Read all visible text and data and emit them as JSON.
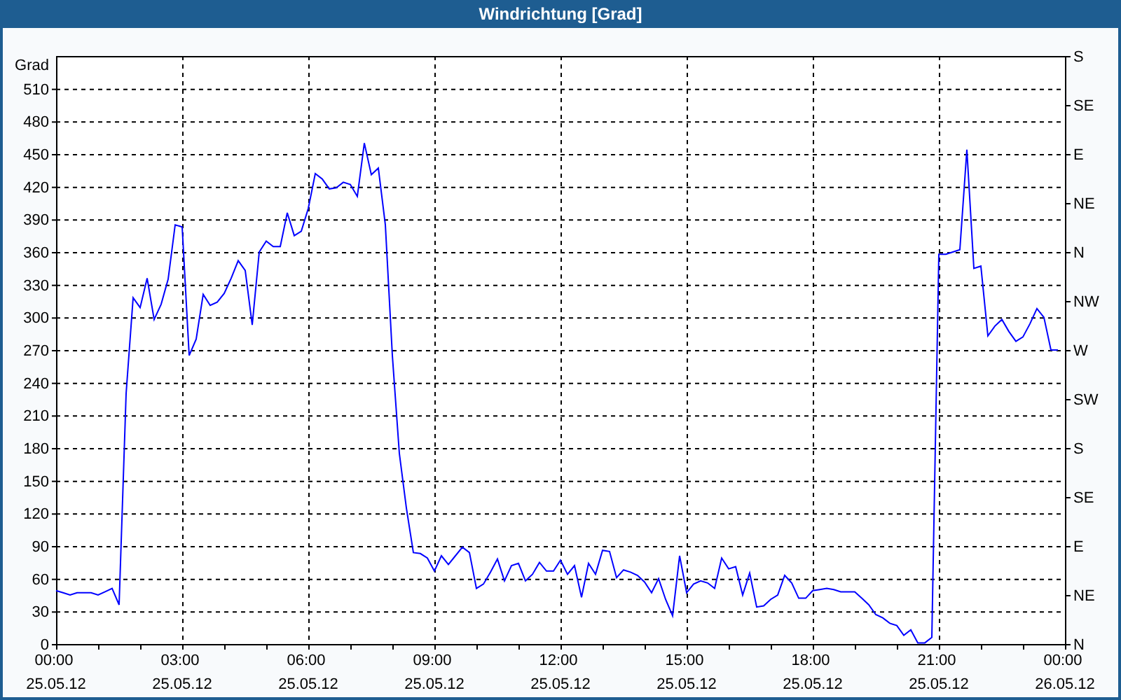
{
  "window": {
    "title": "Windrichtung [Grad]"
  },
  "chart": {
    "right_axis_labels": [
      "S",
      "SE",
      "E",
      "NE",
      "N",
      "NW",
      "W",
      "SW",
      "S",
      "SE",
      "E",
      "NE",
      "N"
    ],
    "chart_data": {
      "type": "line",
      "ylabel": "Grad",
      "ylim": [
        0,
        540
      ],
      "categories": [
        "00:00 25.05.12",
        null,
        null,
        null,
        null,
        null,
        null,
        null,
        null,
        null,
        null,
        null,
        null,
        null,
        null,
        null,
        null,
        null,
        "03:00 25.05.12",
        null,
        null,
        null,
        null,
        null,
        null,
        null,
        null,
        null,
        null,
        null,
        null,
        null,
        null,
        null,
        null,
        null,
        "06:00 25.05.12",
        null,
        null,
        null,
        null,
        null,
        null,
        null,
        null,
        null,
        null,
        null,
        null,
        null,
        null,
        null,
        null,
        null,
        "09:00 25.05.12",
        null,
        null,
        null,
        null,
        null,
        null,
        null,
        null,
        null,
        null,
        null,
        null,
        null,
        null,
        null,
        null,
        null,
        "12:00 25.05.12",
        null,
        null,
        null,
        null,
        null,
        null,
        null,
        null,
        null,
        null,
        null,
        null,
        null,
        null,
        null,
        null,
        null,
        "15:00 25.05.12",
        null,
        null,
        null,
        null,
        null,
        null,
        null,
        null,
        null,
        null,
        null,
        null,
        null,
        null,
        null,
        null,
        null,
        "18:00 25.05.12",
        null,
        null,
        null,
        null,
        null,
        null,
        null,
        null,
        null,
        null,
        null,
        null,
        null,
        null,
        null,
        null,
        null,
        "21:00 25.05.12",
        null,
        null,
        null,
        null,
        null,
        null,
        null,
        null,
        null,
        null,
        null,
        null,
        null,
        null,
        null,
        null,
        null,
        "00:00 26.05.12"
      ],
      "yticks": [
        0,
        30,
        60,
        90,
        120,
        150,
        180,
        210,
        240,
        270,
        300,
        330,
        360,
        390,
        420,
        450,
        480,
        510
      ],
      "grid": true,
      "series": [
        {
          "color": "#0000ff",
          "values": [
            49,
            47,
            45,
            47,
            47,
            47,
            45,
            48,
            51,
            36,
            230,
            318,
            309,
            336,
            298,
            312,
            335,
            385,
            383,
            265,
            280,
            321,
            311,
            314,
            322,
            336,
            352,
            343,
            293,
            360,
            370,
            365,
            365,
            396,
            375,
            379,
            400,
            432,
            427,
            418,
            419,
            424,
            422,
            411,
            460,
            431,
            437,
            385,
            265,
            175,
            125,
            84,
            83,
            79,
            67,
            81,
            73,
            81,
            89,
            84,
            51,
            55,
            66,
            78,
            58,
            72,
            74,
            58,
            64,
            75,
            67,
            67,
            77,
            64,
            72,
            43,
            74,
            64,
            86,
            85,
            61,
            68,
            66,
            63,
            57,
            47,
            60,
            41,
            26,
            81,
            47,
            55,
            58,
            56,
            51,
            79,
            69,
            71,
            45,
            65,
            34,
            35,
            41,
            45,
            63,
            56,
            42,
            42,
            49,
            50,
            51,
            50,
            48,
            48,
            48,
            42,
            36,
            27,
            24,
            19,
            17,
            8,
            13,
            1,
            1,
            6,
            358,
            358,
            360,
            362,
            454,
            345,
            347,
            283,
            292,
            298,
            287,
            278,
            282,
            294,
            308,
            300,
            270,
            270,
            null
          ]
        }
      ]
    }
  }
}
